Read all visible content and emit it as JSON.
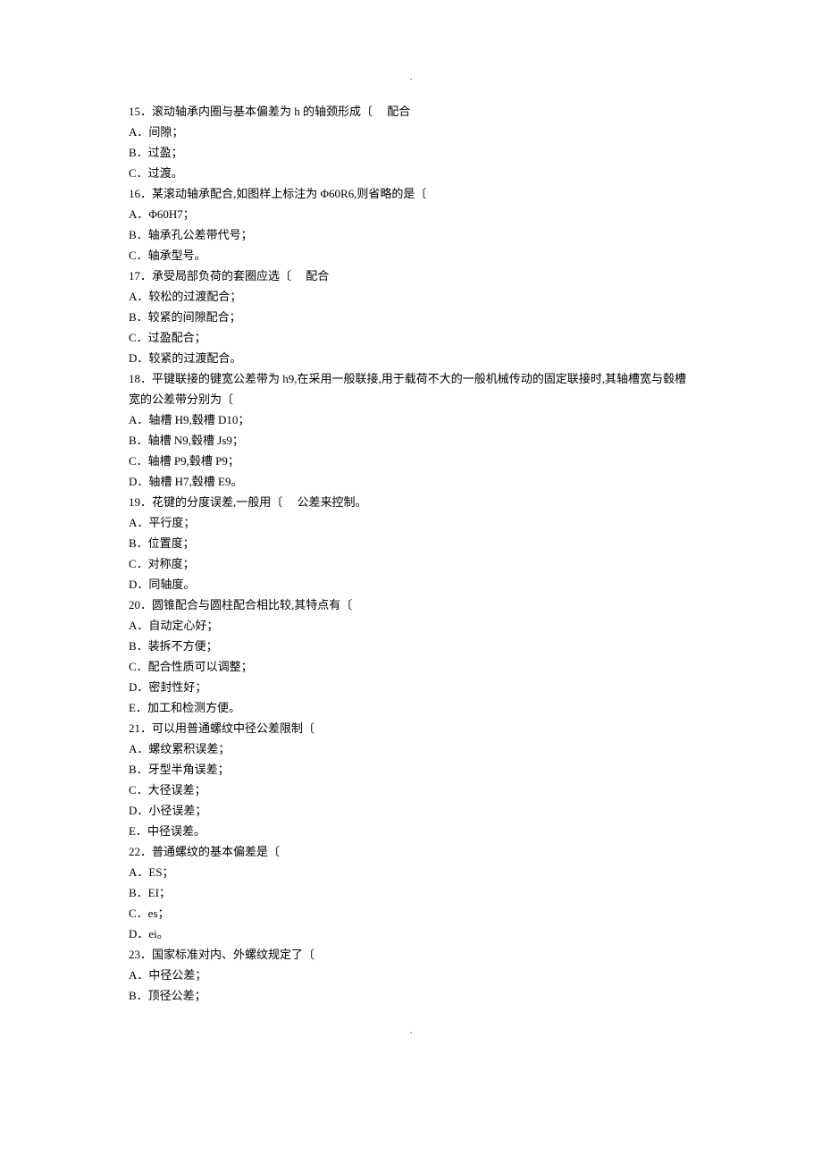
{
  "decor": {
    "dot": "."
  },
  "lines": [
    "15．滚动轴承内圈与基本偏差为 h 的轴颈形成〔     配合",
    "A．间隙；",
    "B．过盈；",
    "C．过渡。",
    "16．某滚动轴承配合,如图样上标注为 Φ60R6,则省略的是〔",
    "A．Φ60H7；",
    "B．轴承孔公差带代号；",
    "C．轴承型号。",
    "17．承受局部负荷的套圈应选〔     配合",
    "A．较松的过渡配合；",
    "B．较紧的间隙配合；",
    "C．过盈配合；",
    "D．较紧的过渡配合。",
    "18．平键联接的键宽公差带为 h9,在采用一般联接,用于载荷不大的一般机械传动的固定联接时,其轴槽宽与毂槽宽的公差带分别为〔",
    "A．轴槽 H9,毂槽 D10；",
    "B．轴槽 N9,毂槽 Js9；",
    "C．轴槽 P9,毂槽 P9；",
    "D．轴槽 H7,毂槽 E9。",
    "19．花键的分度误差,一般用〔     公差来控制。",
    "A．平行度；",
    "B．位置度；",
    "C．对称度；",
    "D．同轴度。",
    "20．圆锥配合与圆柱配合相比较,其特点有〔",
    "A．自动定心好；",
    "B．装拆不方便；",
    "C．配合性质可以调整；",
    "D．密封性好；",
    "E．加工和检测方便。",
    "21．可以用普通螺纹中径公差限制〔",
    "A．螺纹累积误差；",
    "B．牙型半角误差；",
    "C．大径误差；",
    "D．小径误差；",
    "E．中径误差。",
    "22．普通螺纹的基本偏差是〔",
    "A．ES；",
    "B．EI；",
    "C．es；",
    "D．ei。",
    "23．国家标准对内、外螺纹规定了〔",
    "A．中径公差；",
    "B．顶径公差；"
  ]
}
